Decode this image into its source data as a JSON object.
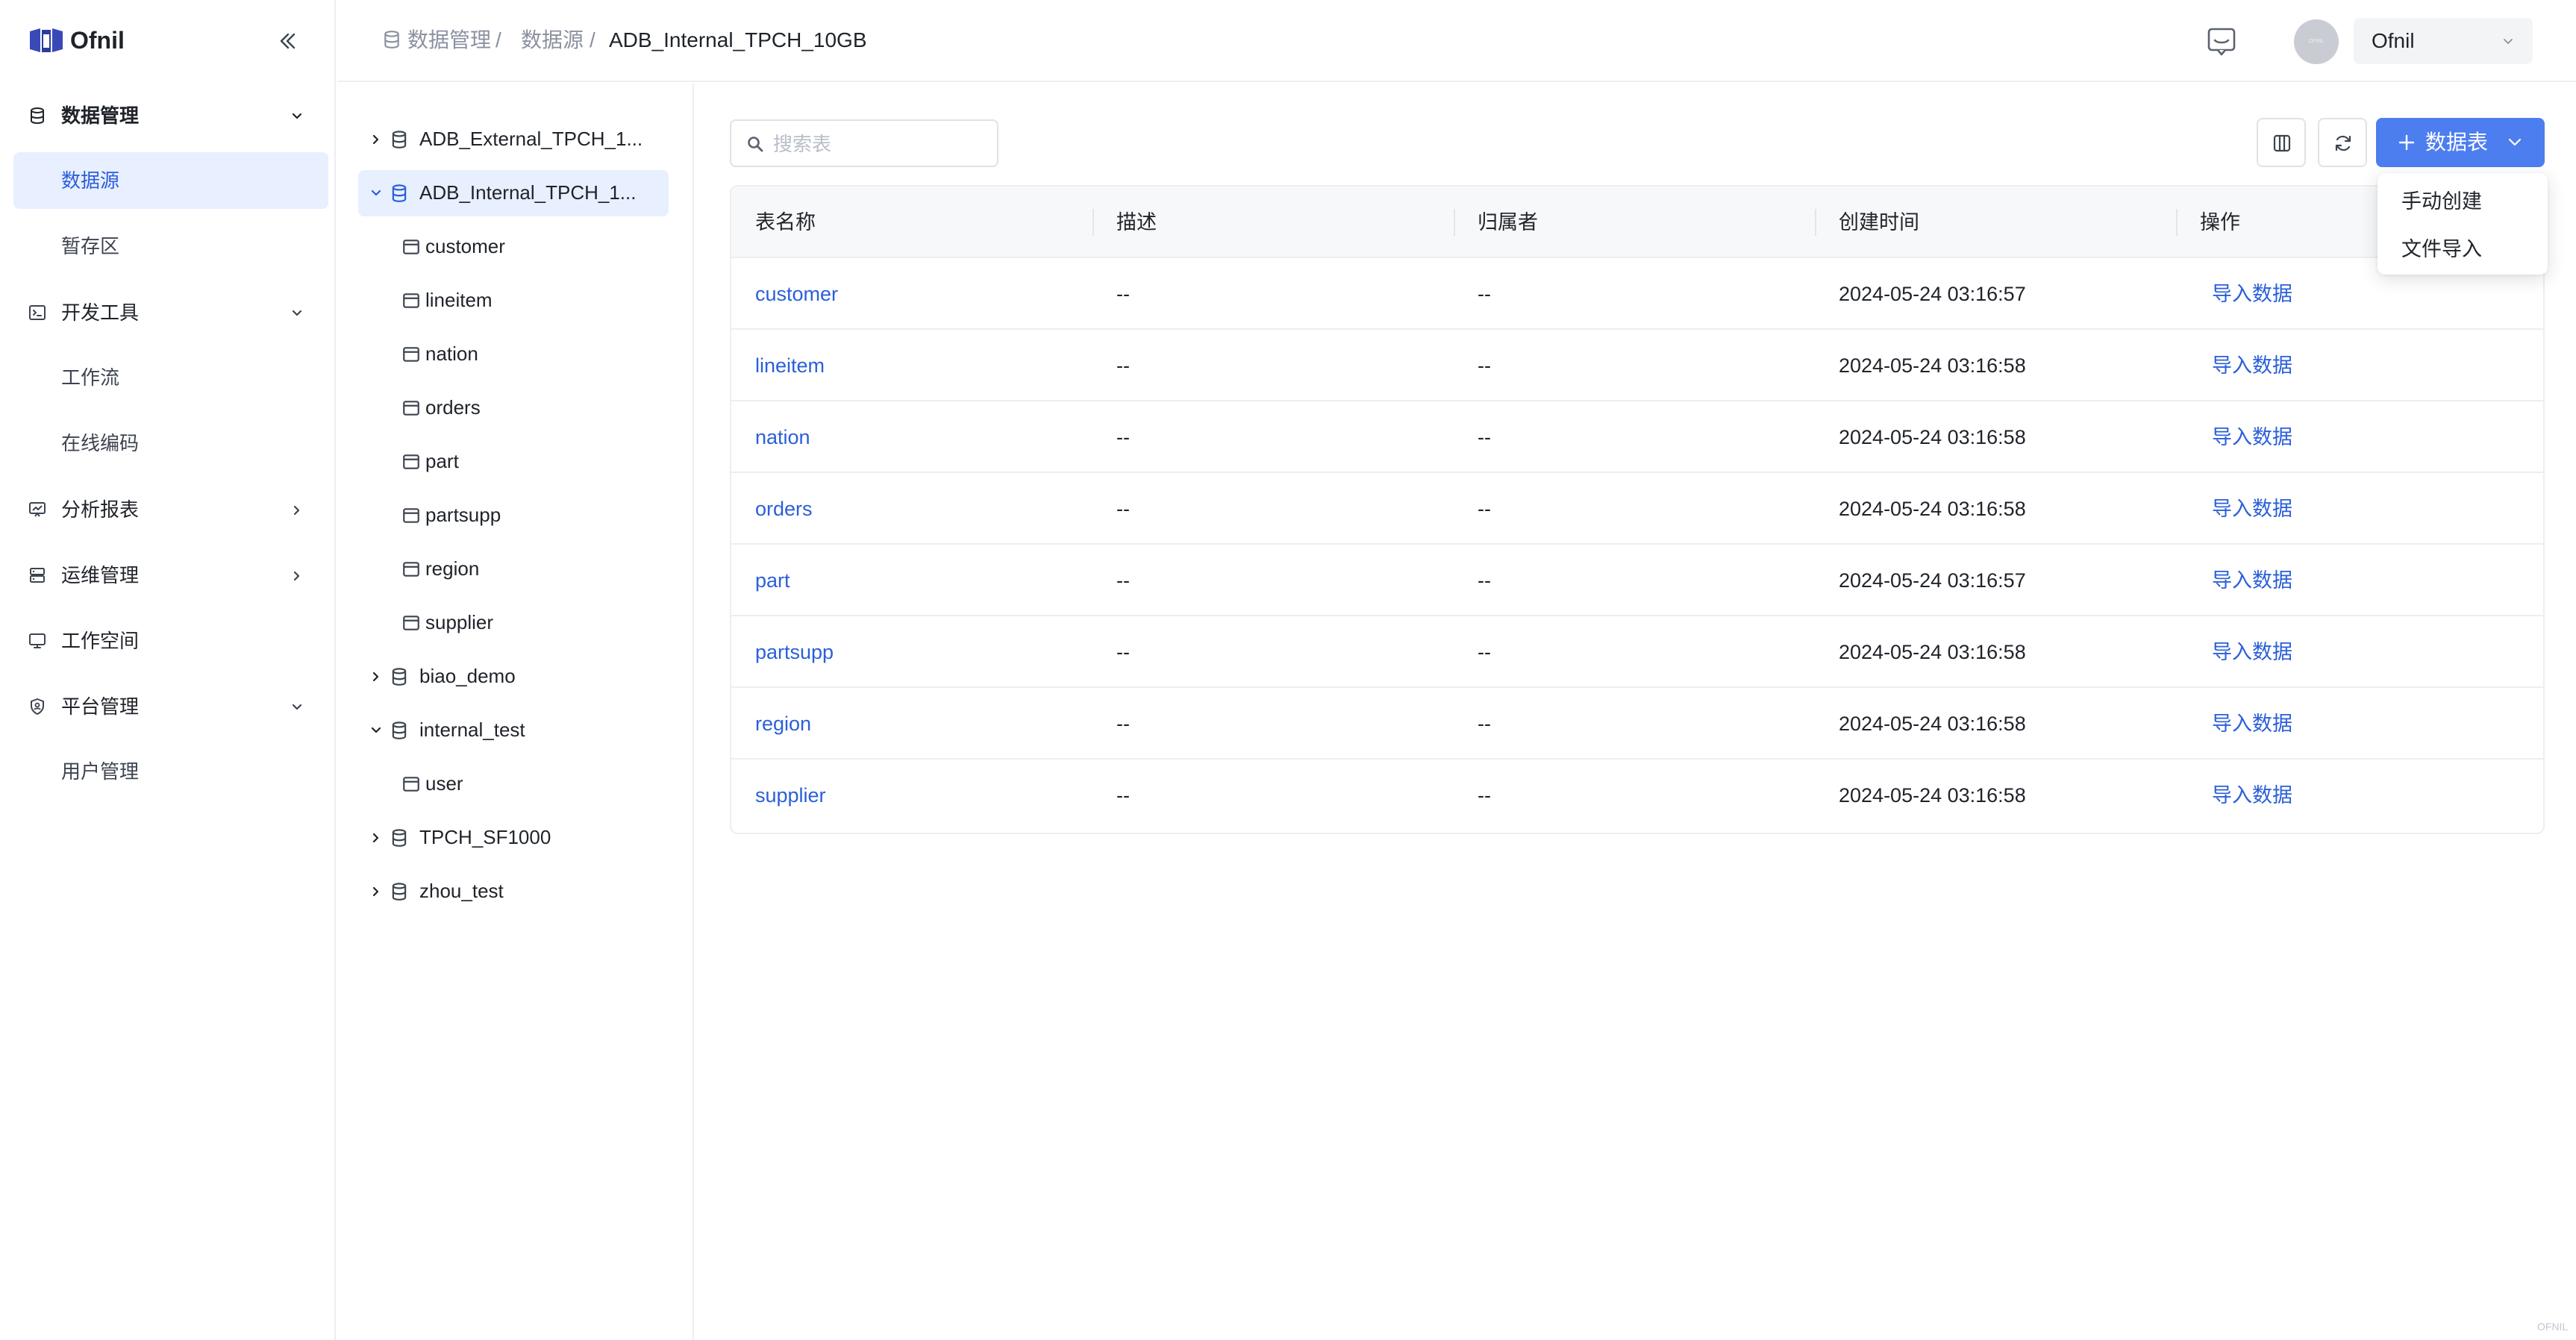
{
  "app": {
    "name": "Ofnil",
    "watermark": "OFNIL"
  },
  "sidebar": {
    "items": [
      {
        "type": "group",
        "label": "数据管理",
        "icon": "database-icon",
        "expanded": true,
        "strong": true
      },
      {
        "type": "sub",
        "label": "数据源",
        "active": true
      },
      {
        "type": "sub",
        "label": "暂存区"
      },
      {
        "type": "group",
        "label": "开发工具",
        "icon": "terminal-icon",
        "expanded": true
      },
      {
        "type": "sub",
        "label": "工作流"
      },
      {
        "type": "sub",
        "label": "在线编码"
      },
      {
        "type": "group",
        "label": "分析报表",
        "icon": "presentation-chart-icon",
        "expanded": false
      },
      {
        "type": "group",
        "label": "运维管理",
        "icon": "server-icon",
        "expanded": false
      },
      {
        "type": "group",
        "label": "工作空间",
        "icon": "monitor-icon"
      },
      {
        "type": "group",
        "label": "平台管理",
        "icon": "shield-icon",
        "expanded": true
      },
      {
        "type": "sub",
        "label": "用户管理"
      }
    ]
  },
  "header": {
    "breadcrumb": [
      "数据管理",
      "数据源",
      "ADB_Internal_TPCH_10GB"
    ],
    "separator": "/",
    "user": {
      "name": "Ofnil",
      "avatar_text": "OFNIL"
    }
  },
  "tree": {
    "nodes": [
      {
        "label": "ADB_External_TPCH_1...",
        "kind": "database",
        "level": 0,
        "expanded": false
      },
      {
        "label": "ADB_Internal_TPCH_1...",
        "kind": "database",
        "level": 0,
        "expanded": true,
        "selected": true
      },
      {
        "label": "customer",
        "kind": "table",
        "level": 1
      },
      {
        "label": "lineitem",
        "kind": "table",
        "level": 1
      },
      {
        "label": "nation",
        "kind": "table",
        "level": 1
      },
      {
        "label": "orders",
        "kind": "table",
        "level": 1
      },
      {
        "label": "part",
        "kind": "table",
        "level": 1
      },
      {
        "label": "partsupp",
        "kind": "table",
        "level": 1
      },
      {
        "label": "region",
        "kind": "table",
        "level": 1
      },
      {
        "label": "supplier",
        "kind": "table",
        "level": 1
      },
      {
        "label": "biao_demo",
        "kind": "database",
        "level": 0,
        "expanded": false
      },
      {
        "label": "internal_test",
        "kind": "database",
        "level": 0,
        "expanded": true
      },
      {
        "label": "user",
        "kind": "table",
        "level": 1
      },
      {
        "label": "TPCH_SF1000",
        "kind": "database",
        "level": 0,
        "expanded": false
      },
      {
        "label": "zhou_test",
        "kind": "database",
        "level": 0,
        "expanded": false
      }
    ]
  },
  "toolbar": {
    "search_placeholder": "搜索表",
    "add_button_label": "数据表",
    "dropdown_items": [
      "手动创建",
      "文件导入"
    ]
  },
  "table": {
    "headers": [
      "表名称",
      "描述",
      "归属者",
      "创建时间",
      "操作"
    ],
    "rows": [
      {
        "name": "customer",
        "desc": "--",
        "owner": "--",
        "created": "2024-05-24 03:16:57",
        "action": "导入数据"
      },
      {
        "name": "lineitem",
        "desc": "--",
        "owner": "--",
        "created": "2024-05-24 03:16:58",
        "action": "导入数据"
      },
      {
        "name": "nation",
        "desc": "--",
        "owner": "--",
        "created": "2024-05-24 03:16:58",
        "action": "导入数据"
      },
      {
        "name": "orders",
        "desc": "--",
        "owner": "--",
        "created": "2024-05-24 03:16:58",
        "action": "导入数据"
      },
      {
        "name": "part",
        "desc": "--",
        "owner": "--",
        "created": "2024-05-24 03:16:57",
        "action": "导入数据"
      },
      {
        "name": "partsupp",
        "desc": "--",
        "owner": "--",
        "created": "2024-05-24 03:16:58",
        "action": "导入数据"
      },
      {
        "name": "region",
        "desc": "--",
        "owner": "--",
        "created": "2024-05-24 03:16:58",
        "action": "导入数据"
      },
      {
        "name": "supplier",
        "desc": "--",
        "owner": "--",
        "created": "2024-05-24 03:16:58",
        "action": "导入数据"
      }
    ]
  },
  "colors": {
    "accent": "#4d7ef0",
    "link": "#2b5fd9",
    "active_bg": "#e8efff",
    "text": "#1f2329",
    "muted": "#8a919f"
  }
}
